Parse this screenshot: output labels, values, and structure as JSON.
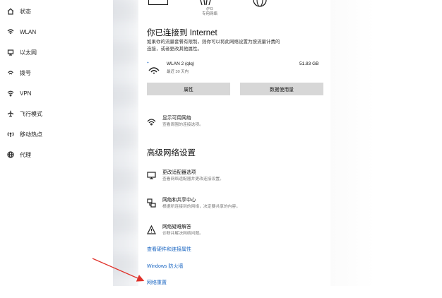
{
  "sidebar": {
    "items": [
      {
        "label": "状态",
        "icon": "home-status-icon"
      },
      {
        "label": "WLAN",
        "icon": "wifi-icon"
      },
      {
        "label": "以太网",
        "icon": "ethernet-icon"
      },
      {
        "label": "拨号",
        "icon": "dialup-icon"
      },
      {
        "label": "VPN",
        "icon": "vpn-icon"
      },
      {
        "label": "飞行模式",
        "icon": "airplane-icon"
      },
      {
        "label": "移动热点",
        "icon": "hotspot-icon"
      },
      {
        "label": "代理",
        "icon": "globe-icon"
      }
    ]
  },
  "status": {
    "topology_caption": "(FG\n专用网络",
    "connected_title": "你已连接到 Internet",
    "connected_desc_1": "如果你的流量套餐有限制，则你可以将此网络设置为按流量计费的",
    "connected_desc_2": "连接，或者更改其他属性。",
    "connection": {
      "name": "WLAN 2 (qlq)",
      "sub": "最近 30 天内",
      "usage": "51.83 GB"
    },
    "buttons": {
      "properties": "属性",
      "data_usage": "数据使用量"
    },
    "show_networks": {
      "title": "显示可用网络",
      "sub": "查看周围的连接选项。"
    }
  },
  "advanced": {
    "heading": "高级网络设置",
    "items": [
      {
        "title": "更改适配器选项",
        "sub": "查看网络适配器并更改连接设置。",
        "icon": "adapter-icon"
      },
      {
        "title": "网络和共享中心",
        "sub": "根据所连接到的网络，决定要共享的内容。",
        "icon": "sharing-center-icon"
      },
      {
        "title": "网络疑难解答",
        "sub": "诊断并解决网络问题。",
        "icon": "warning-icon"
      }
    ],
    "links": {
      "hardware": "查看硬件和连接属性",
      "firewall": "Windows 防火墙",
      "reset": "网络重置"
    }
  },
  "colors": {
    "link": "#1a66c2",
    "button": "#d7d7d7",
    "arrow": "#e0322b"
  }
}
